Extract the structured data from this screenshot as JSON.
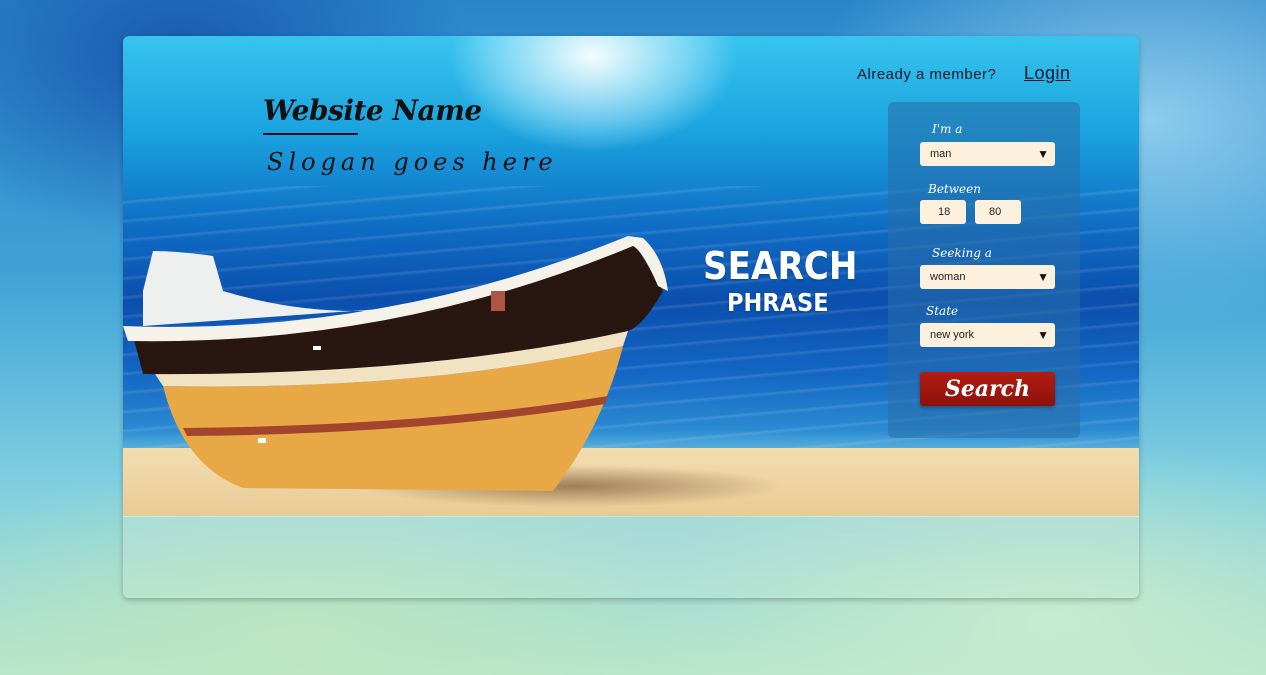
{
  "brand": {
    "site_name": "Website Name",
    "slogan": "Slogan goes here"
  },
  "header": {
    "member_text": "Already a member?",
    "login_label": "Login"
  },
  "hero": {
    "phrase_line1": "SEARCH",
    "phrase_line2": "PHRASE"
  },
  "search_form": {
    "im_a_label": "I'm a",
    "im_a_value": "man",
    "between_label": "Between",
    "age_min": "18",
    "age_max": "80",
    "seeking_label": "Seeking a",
    "seeking_value": "woman",
    "state_label": "State",
    "state_value": "new york",
    "search_button": "Search"
  },
  "icons": {
    "dropdown": "chevron-down-icon"
  },
  "colors": {
    "search_button": "#a3180d",
    "input_background": "#fdf1de",
    "panel_background": "#2e6ea8"
  }
}
